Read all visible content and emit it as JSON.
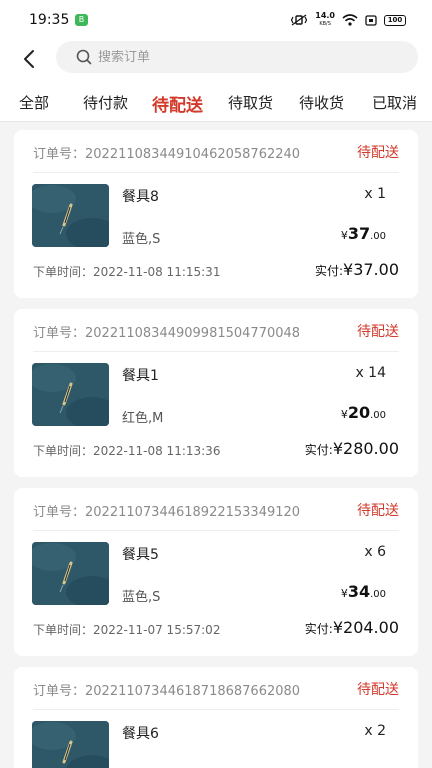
{
  "status_bar": {
    "time": "19:35",
    "app_badge": "B",
    "net_speed": "14.0",
    "net_unit": "KB/S",
    "battery": "100"
  },
  "header": {
    "search_placeholder": "搜索订单"
  },
  "tabs": [
    {
      "label": "全部"
    },
    {
      "label": "待付款"
    },
    {
      "label": "待配送",
      "active": true
    },
    {
      "label": "待取货"
    },
    {
      "label": "待收货"
    },
    {
      "label": "已取消"
    }
  ],
  "colors": {
    "accent": "#d23a2b",
    "card_bg": "#ffffff",
    "page_bg": "#f4f4f4"
  },
  "orders": [
    {
      "order_no": "订单号：20221108344910462058762240",
      "status": "待配送",
      "product_name": "餐具8",
      "spec": "蓝色,S",
      "qty": "x 1",
      "price_currency": "¥",
      "price_int": "37",
      "price_dec": ".00",
      "order_time": "下单时间：2022-11-08 11:15:31",
      "paid_label": "实付:",
      "paid_amount": "¥37.00"
    },
    {
      "order_no": "订单号：20221108344909981504770048",
      "status": "待配送",
      "product_name": "餐具1",
      "spec": "红色,M",
      "qty": "x 14",
      "price_currency": "¥",
      "price_int": "20",
      "price_dec": ".00",
      "order_time": "下单时间：2022-11-08 11:13:36",
      "paid_label": "实付:",
      "paid_amount": "¥280.00"
    },
    {
      "order_no": "订单号：20221107344618922153349120",
      "status": "待配送",
      "product_name": "餐具5",
      "spec": "蓝色,S",
      "qty": "x 6",
      "price_currency": "¥",
      "price_int": "34",
      "price_dec": ".00",
      "order_time": "下单时间：2022-11-07 15:57:02",
      "paid_label": "实付:",
      "paid_amount": "¥204.00"
    },
    {
      "order_no": "订单号：20221107344618718687662080",
      "status": "待配送",
      "product_name": "餐具6",
      "spec": "",
      "qty": "x 2",
      "price_currency": "",
      "price_int": "",
      "price_dec": "",
      "order_time": "",
      "paid_label": "",
      "paid_amount": ""
    }
  ]
}
